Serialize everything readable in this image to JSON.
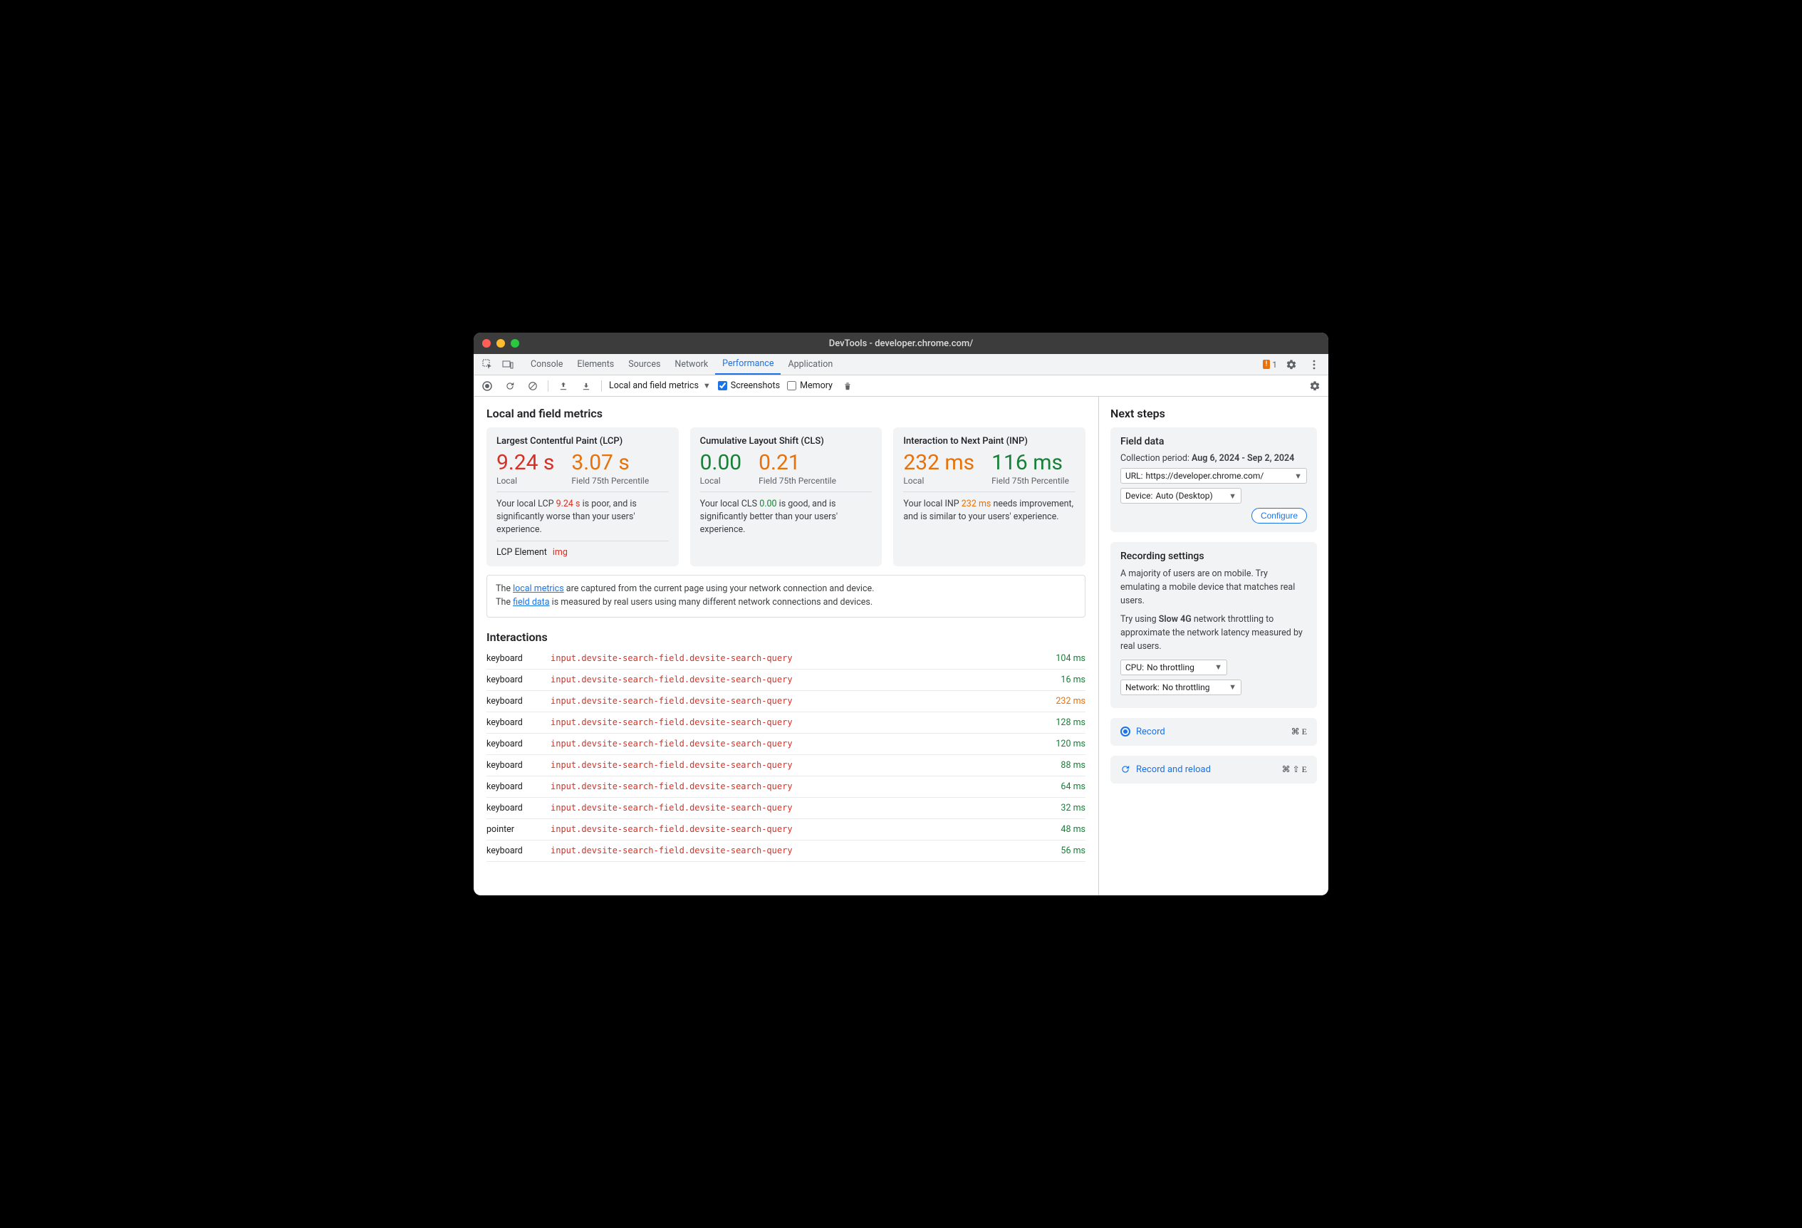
{
  "window": {
    "title": "DevTools - developer.chrome.com/"
  },
  "tabs": [
    "Console",
    "Elements",
    "Sources",
    "Network",
    "Performance",
    "Application"
  ],
  "active_tab_index": 4,
  "warning_count": "1",
  "toolbar": {
    "selector": "Local and field metrics",
    "screenshots_label": "Screenshots",
    "memory_label": "Memory"
  },
  "main": {
    "heading": "Local and field metrics",
    "cards": [
      {
        "title": "Largest Contentful Paint (LCP)",
        "local_val": "9.24 s",
        "local_class": "red",
        "field_val": "3.07 s",
        "field_class": "orange",
        "local_label": "Local",
        "field_label": "Field 75th Percentile",
        "desc_pre": "Your local LCP ",
        "desc_val": "9.24 s",
        "desc_val_class": "red",
        "desc_post": " is poor, and is significantly worse than your users' experience.",
        "lcp_label": "LCP Element",
        "lcp_tag": "img"
      },
      {
        "title": "Cumulative Layout Shift (CLS)",
        "local_val": "0.00",
        "local_class": "green",
        "field_val": "0.21",
        "field_class": "orange",
        "local_label": "Local",
        "field_label": "Field 75th Percentile",
        "desc_pre": "Your local CLS ",
        "desc_val": "0.00",
        "desc_val_class": "green",
        "desc_post": " is good, and is significantly better than your users' experience."
      },
      {
        "title": "Interaction to Next Paint (INP)",
        "local_val": "232 ms",
        "local_class": "orange",
        "field_val": "116 ms",
        "field_class": "green",
        "local_label": "Local",
        "field_label": "Field 75th Percentile",
        "desc_pre": "Your local INP ",
        "desc_val": "232 ms",
        "desc_val_class": "orange",
        "desc_post": " needs improvement, and is similar to your users' experience."
      }
    ],
    "info_pre1": "The ",
    "info_link1": "local metrics",
    "info_post1": " are captured from the current page using your network connection and device.",
    "info_pre2": "The ",
    "info_link2": "field data",
    "info_post2": " is measured by real users using many different network connections and devices.",
    "interactions_heading": "Interactions",
    "interactions": [
      {
        "type": "keyboard",
        "sel": "input.devsite-search-field.devsite-search-query",
        "dur": "104 ms",
        "dur_class": "green"
      },
      {
        "type": "keyboard",
        "sel": "input.devsite-search-field.devsite-search-query",
        "dur": "16 ms",
        "dur_class": "green"
      },
      {
        "type": "keyboard",
        "sel": "input.devsite-search-field.devsite-search-query",
        "dur": "232 ms",
        "dur_class": "orange"
      },
      {
        "type": "keyboard",
        "sel": "input.devsite-search-field.devsite-search-query",
        "dur": "128 ms",
        "dur_class": "green"
      },
      {
        "type": "keyboard",
        "sel": "input.devsite-search-field.devsite-search-query",
        "dur": "120 ms",
        "dur_class": "green"
      },
      {
        "type": "keyboard",
        "sel": "input.devsite-search-field.devsite-search-query",
        "dur": "88 ms",
        "dur_class": "green"
      },
      {
        "type": "keyboard",
        "sel": "input.devsite-search-field.devsite-search-query",
        "dur": "64 ms",
        "dur_class": "green"
      },
      {
        "type": "keyboard",
        "sel": "input.devsite-search-field.devsite-search-query",
        "dur": "32 ms",
        "dur_class": "green"
      },
      {
        "type": "pointer",
        "sel": "input.devsite-search-field.devsite-search-query",
        "dur": "48 ms",
        "dur_class": "green"
      },
      {
        "type": "keyboard",
        "sel": "input.devsite-search-field.devsite-search-query",
        "dur": "56 ms",
        "dur_class": "green"
      }
    ]
  },
  "side": {
    "heading": "Next steps",
    "field_data": {
      "title": "Field data",
      "period_label": "Collection period: ",
      "period_value": "Aug 6, 2024 - Sep 2, 2024",
      "url_label": "URL:",
      "url_value": "https://developer.chrome.com/",
      "device_label": "Device:",
      "device_value": "Auto (Desktop)",
      "configure": "Configure"
    },
    "recording": {
      "title": "Recording settings",
      "text1": "A majority of users are on mobile. Try emulating a mobile device that matches real users.",
      "text2_pre": "Try using ",
      "text2_bold": "Slow 4G",
      "text2_post": " network throttling to approximate the network latency measured by real users.",
      "cpu_label": "CPU:",
      "cpu_value": "No throttling",
      "net_label": "Network:",
      "net_value": "No throttling"
    },
    "record": {
      "label": "Record",
      "shortcut": "⌘ E"
    },
    "record_reload": {
      "label": "Record and reload",
      "shortcut": "⌘ ⇧ E"
    }
  }
}
